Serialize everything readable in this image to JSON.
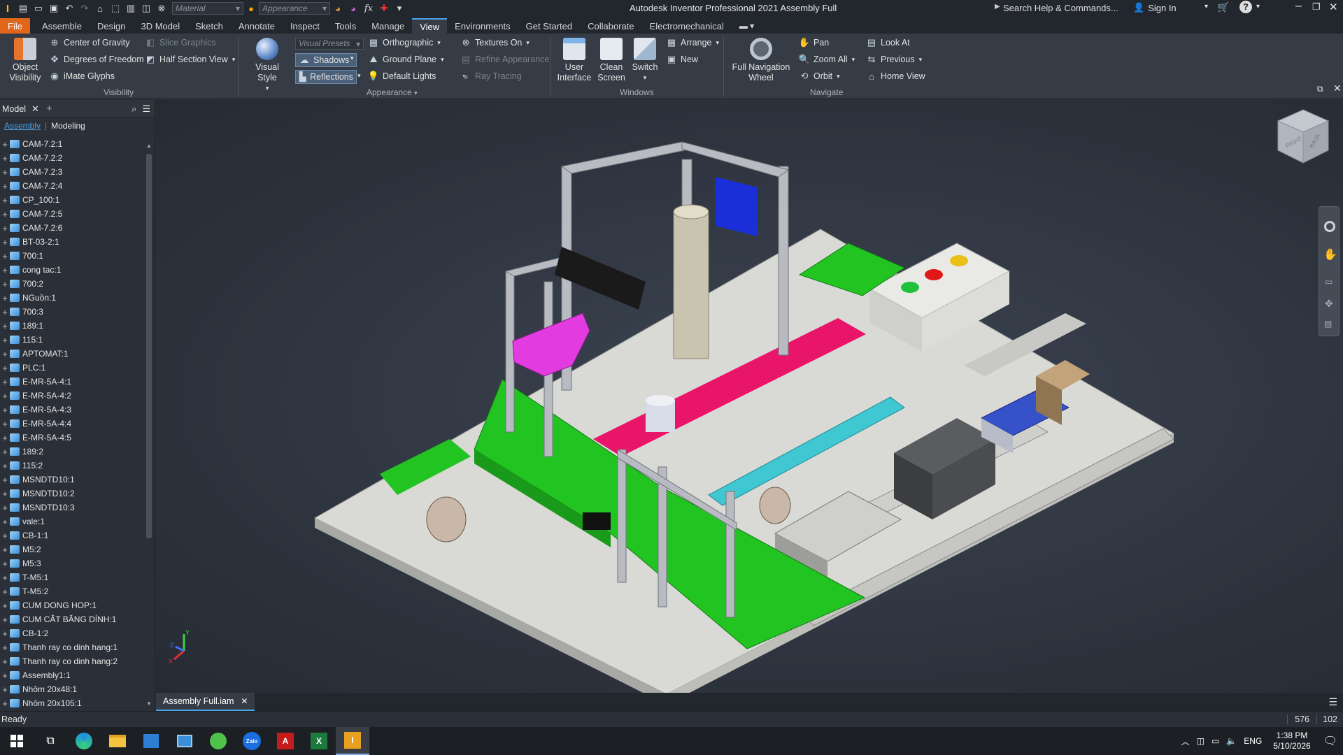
{
  "titlebar": {
    "app_letter": "I",
    "material_placeholder": "Material",
    "appearance_placeholder": "Appearance",
    "title": "Autodesk Inventor Professional 2021    Assembly Full",
    "search": "Search Help & Commands...",
    "sign_in": "Sign In"
  },
  "tabs": [
    "File",
    "Assemble",
    "Design",
    "3D Model",
    "Sketch",
    "Annotate",
    "Inspect",
    "Tools",
    "Manage",
    "View",
    "Environments",
    "Get Started",
    "Collaborate",
    "Electromechanical"
  ],
  "active_tab": "View",
  "ribbon": {
    "object_visibility": "Object\nVisibility",
    "center_of_gravity": "Center of Gravity",
    "degrees_of_freedom": "Degrees of Freedom",
    "imate_glyphs": "iMate Glyphs",
    "slice_graphics": "Slice Graphics",
    "half_section_view": "Half Section View",
    "visibility_label": "Visibility",
    "visual_style": "Visual Style",
    "visual_presets": "Visual Presets",
    "shadows": "Shadows",
    "reflections": "Reflections",
    "orthographic": "Orthographic",
    "ground_plane": "Ground Plane",
    "default_lights": "Default Lights",
    "textures_on": "Textures On",
    "refine_appearance": "Refine Appearance",
    "ray_tracing": "Ray Tracing",
    "appearance_label": "Appearance",
    "user_interface": "User\nInterface",
    "clean_screen": "Clean\nScreen",
    "switch": "Switch",
    "arrange": "Arrange",
    "new": "New",
    "windows_label": "Windows",
    "full_navigation_wheel": "Full Navigation\nWheel",
    "pan": "Pan",
    "zoom_all": "Zoom All",
    "orbit": "Orbit",
    "look_at": "Look At",
    "previous": "Previous",
    "home_view": "Home View",
    "navigate_label": "Navigate"
  },
  "browser": {
    "title": "Model",
    "tab_assembly": "Assembly",
    "tab_modeling": "Modeling",
    "items": [
      "CAM-7.2:1",
      "CAM-7.2:2",
      "CAM-7.2:3",
      "CAM-7.2:4",
      "CP_100:1",
      "CAM-7.2:5",
      "CAM-7.2:6",
      "BT-03-2:1",
      "700:1",
      "cong tac:1",
      "700:2",
      "NGuồn:1",
      "700:3",
      "189:1",
      "115:1",
      "APTOMAT:1",
      "PLC:1",
      "E-MR-5A-4:1",
      "E-MR-5A-4:2",
      "E-MR-5A-4:3",
      "E-MR-5A-4:4",
      "E-MR-5A-4:5",
      "189:2",
      "115:2",
      "MSNDTD10:1",
      "MSNDTD10:2",
      "MSNDTD10:3",
      "vale:1",
      "CB-1:1",
      "M5:2",
      "M5:3",
      "T-M5:1",
      "T-M5:2",
      "CUM DONG HOP:1",
      "CUM CẮT BĂNG DÍNH:1",
      "CB-1:2",
      "Thanh ray co dinh hang:1",
      "Thanh ray co dinh hang:2",
      "Assembly1:1",
      "Nhôm 20x48:1",
      "Nhôm 20x105:1"
    ]
  },
  "viewcube": {
    "right": "RIGHT",
    "back": "BACK"
  },
  "axes": {
    "x": "X",
    "y": "Y",
    "z": "Z"
  },
  "document_tab": "Assembly Full.iam",
  "status": {
    "text": "Ready",
    "count1": "576",
    "count2": "102"
  },
  "taskbar": {
    "lang": "ENG",
    "time": "1:38 PM",
    "date": "5/10/2026"
  },
  "colors": {
    "accent": "#e0661b",
    "green_belt": "#22c422",
    "pink_plate": "#e8156a",
    "magenta_part": "#e23ce0",
    "blue_part": "#1a2fd8"
  }
}
